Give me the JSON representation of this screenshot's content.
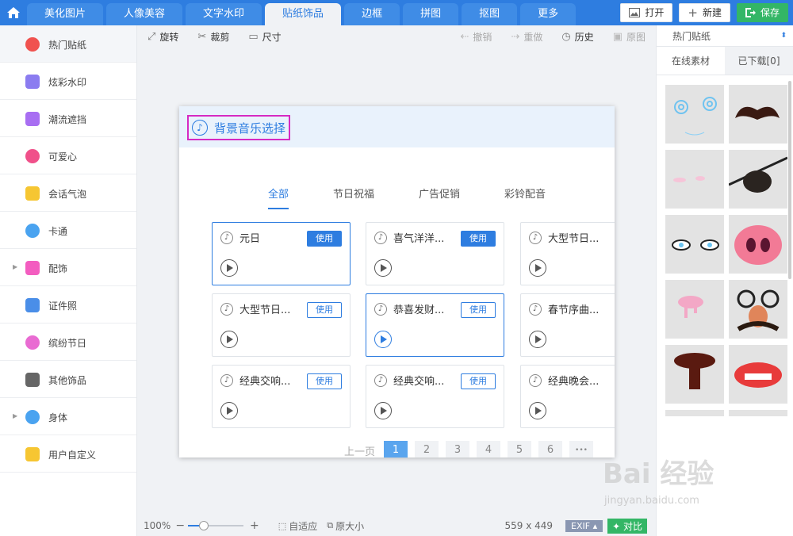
{
  "topbar": {
    "tabs": [
      "美化图片",
      "人像美容",
      "文字水印",
      "贴纸饰品",
      "边框",
      "拼图",
      "抠图",
      "更多"
    ],
    "active_tab": 3,
    "buttons": {
      "open": "打开",
      "new": "新建",
      "save": "保存"
    }
  },
  "sidebar": {
    "items": [
      {
        "label": "热门贴纸",
        "icon": "flame-icon",
        "color": "#f0524f"
      },
      {
        "label": "炫彩水印",
        "icon": "watermark-icon",
        "color": "#8b7cf0"
      },
      {
        "label": "潮流遮挡",
        "icon": "mask-icon",
        "color": "#a86ef2"
      },
      {
        "label": "可爱心",
        "icon": "heart-icon",
        "color": "#f0508a"
      },
      {
        "label": "会话气泡",
        "icon": "speech-bubble-icon",
        "color": "#f6c632"
      },
      {
        "label": "卡通",
        "icon": "bear-icon",
        "color": "#4aa3f0"
      },
      {
        "label": "配饰",
        "icon": "bow-icon",
        "color": "#f35dc0"
      },
      {
        "label": "证件照",
        "icon": "id-photo-icon",
        "color": "#4a8ee8"
      },
      {
        "label": "缤纷节日",
        "icon": "balloon-icon",
        "color": "#e96bd2"
      },
      {
        "label": "其他饰品",
        "icon": "grid-icon",
        "color": "#666666"
      },
      {
        "label": "身体",
        "icon": "person-icon",
        "color": "#4aa3f0"
      },
      {
        "label": "用户自定义",
        "icon": "pencil-icon",
        "color": "#f6c632"
      }
    ]
  },
  "toolbar": {
    "rotate": "旋转",
    "crop": "裁剪",
    "size": "尺寸",
    "undo": "撤销",
    "redo": "重做",
    "history": "历史",
    "original": "原图"
  },
  "modal": {
    "title": "背景音乐选择",
    "tabs": [
      "全部",
      "节日祝福",
      "广告促销",
      "彩铃配音"
    ],
    "use_label": "使用",
    "cards": [
      [
        "元日",
        "喜气洋洋...",
        "大型节日..."
      ],
      [
        "大型节日...",
        "恭喜发财...",
        "春节序曲..."
      ],
      [
        "经典交响...",
        "经典交响...",
        "经典晚会..."
      ]
    ],
    "pager": {
      "prev": "上一页",
      "pages": [
        "1",
        "2",
        "3",
        "4",
        "5",
        "6",
        "•••"
      ]
    }
  },
  "bottombar": {
    "zoom": "100%",
    "fit": "自适应",
    "original_size": "原大小",
    "dimensions": "559 x 449",
    "exif": "EXIF",
    "compare": "对比"
  },
  "rpanel": {
    "select": "热门贴纸",
    "tab_online": "在线素材",
    "tab_downloaded": "已下载[0]"
  },
  "watermark": {
    "brand": "Bai  经验",
    "url": "jingyan.baidu.com"
  }
}
